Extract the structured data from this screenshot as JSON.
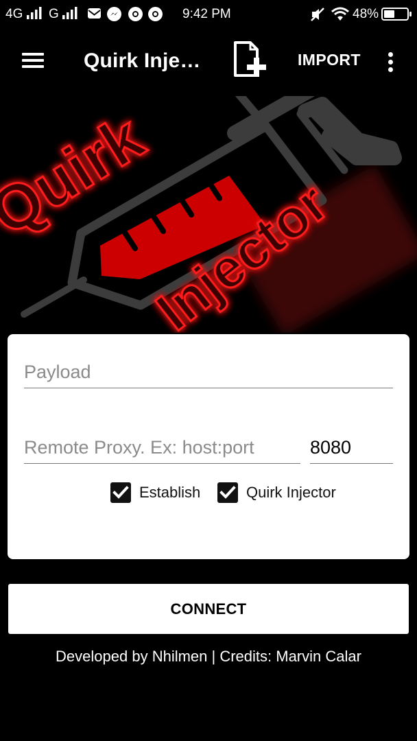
{
  "status_bar": {
    "network_1": "4G",
    "network_2": "G",
    "time": "9:42 PM",
    "battery_percent": "48%",
    "battery_level": 0.48,
    "icons": [
      "signal-icon",
      "signal-icon",
      "mail-icon",
      "messenger-icon",
      "chrome-icon",
      "chrome-icon",
      "mute-icon",
      "wifi-icon",
      "battery-icon"
    ]
  },
  "toolbar": {
    "title": "Quirk Inje…",
    "import_label": "IMPORT",
    "icons": [
      "menu-icon",
      "add-file-icon",
      "more-vert-icon"
    ]
  },
  "logo": {
    "word_1": "Quirk",
    "word_2": "Injector",
    "accent_color": "#d40000",
    "glow_color": "#ff1a1a",
    "syringe_color": "#3a3a3a"
  },
  "form": {
    "payload": {
      "placeholder": "Payload",
      "value": ""
    },
    "remote_proxy": {
      "placeholder": "Remote Proxy. Ex: host:port",
      "value": ""
    },
    "port": {
      "placeholder": "",
      "value": "8080"
    },
    "checkboxes": [
      {
        "label": "Establish",
        "checked": true
      },
      {
        "label": "Quirk Injector",
        "checked": true
      }
    ]
  },
  "connect_label": "CONNECT",
  "credits": "Developed by Nhilmen | Credits: Marvin Calar"
}
